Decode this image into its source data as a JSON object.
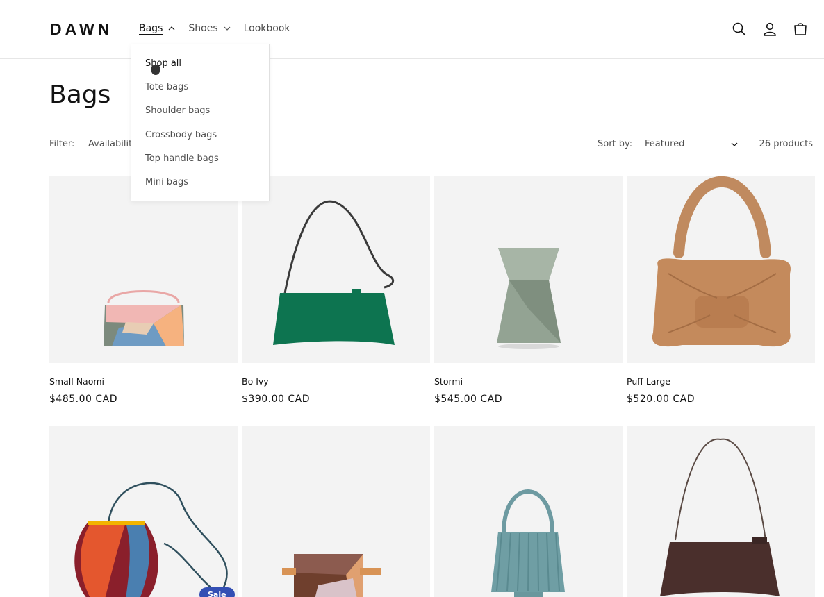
{
  "header": {
    "logo": "DAWN",
    "nav": [
      {
        "label": "Bags",
        "active": true,
        "expanded": true
      },
      {
        "label": "Shoes",
        "active": false,
        "expanded": false
      },
      {
        "label": "Lookbook",
        "active": false
      }
    ],
    "icons": [
      "search-icon",
      "account-icon",
      "cart-icon"
    ]
  },
  "dropdown": {
    "items": [
      "Shop all",
      "Tote bags",
      "Shoulder bags",
      "Crossbody bags",
      "Top handle bags",
      "Mini bags"
    ],
    "active_index": 0
  },
  "page": {
    "title": "Bags",
    "filter_label": "Filter:",
    "filter_availability": "Availability",
    "sort_label": "Sort by:",
    "sort_value": "Featured",
    "product_count": "26 products"
  },
  "products": [
    {
      "name": "Small Naomi",
      "price": "$485.00 CAD"
    },
    {
      "name": "Bo Ivy",
      "price": "$390.00 CAD"
    },
    {
      "name": "Stormi",
      "price": "$545.00 CAD"
    },
    {
      "name": "Puff Large",
      "price": "$520.00 CAD"
    },
    {
      "name": "",
      "price": ""
    },
    {
      "name": "",
      "price": ""
    },
    {
      "name": "",
      "price": ""
    },
    {
      "name": "",
      "price": ""
    }
  ],
  "sale_badge": "Sale",
  "colors": {
    "text": "#121212",
    "media_bg": "#f3f3f3",
    "sale_badge": "#334fb4",
    "border": "#e6e6e6"
  }
}
